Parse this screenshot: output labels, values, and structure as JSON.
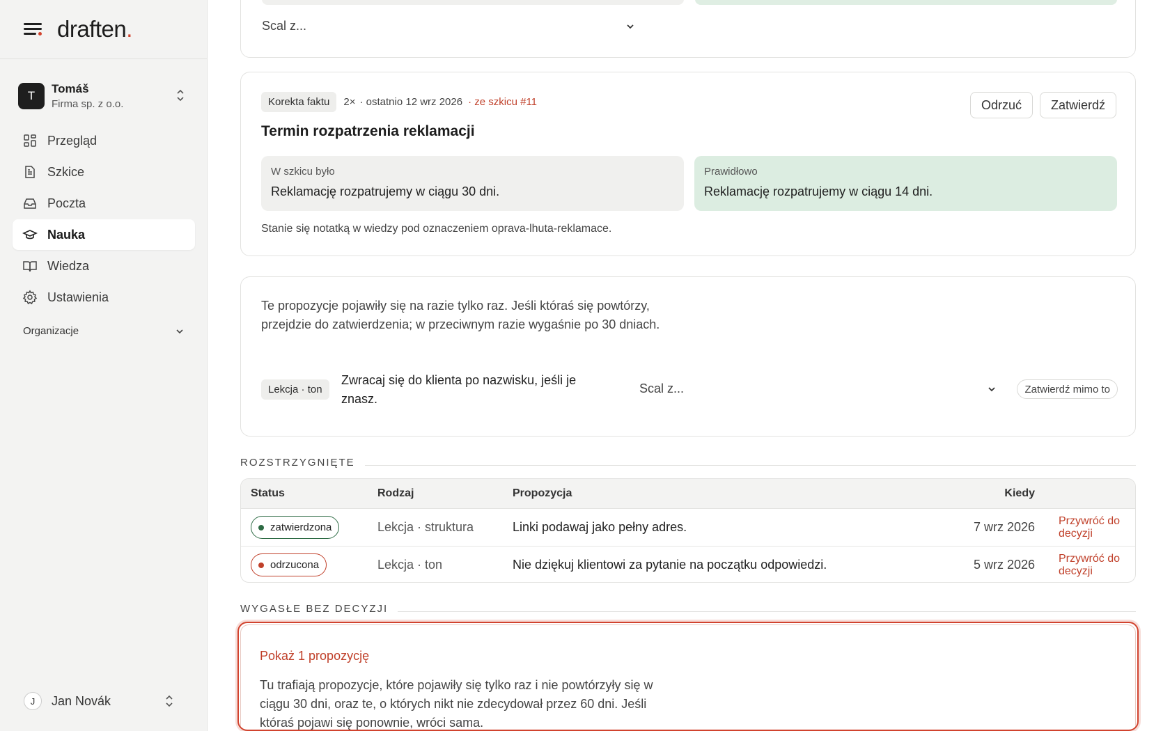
{
  "brand": {
    "name": "draften",
    "dot": "."
  },
  "account": {
    "initial": "T",
    "name": "Tomáš",
    "org": "Firma sp. z o.o."
  },
  "nav": [
    {
      "label": "Przegląd",
      "icon": "grid-icon"
    },
    {
      "label": "Szkice",
      "icon": "document-icon"
    },
    {
      "label": "Poczta",
      "icon": "inbox-icon"
    },
    {
      "label": "Nauka",
      "icon": "graduation-cap-icon",
      "active": true
    },
    {
      "label": "Wiedza",
      "icon": "book-icon"
    },
    {
      "label": "Ustawienia",
      "icon": "gear-icon"
    }
  ],
  "organizations_label": "Organizacje",
  "user": {
    "initial": "J",
    "name": "Jan Novák"
  },
  "top_card": {
    "merge_placeholder": "Scal z..."
  },
  "fact_card": {
    "tag": "Korekta faktu",
    "count": "2×",
    "last_seen": "· ostatnio 12 wrz 2026",
    "source": "· ze szkicu #11",
    "reject_label": "Odrzuć",
    "approve_label": "Zatwierdź",
    "title": "Termin rozpatrzenia reklamacji",
    "was_label": "W szkicu było",
    "was_text": "Reklamację rozpatrujemy w ciągu 30 dni.",
    "correct_label": "Prawidłowo",
    "correct_text": "Reklamację rozpatrujemy w ciągu 14 dni.",
    "note": "Stanie się notatką w wiedzy pod oznaczeniem oprava-lhuta-reklamace."
  },
  "once_card": {
    "intro": "Te propozycje pojawiły się na razie tylko raz. Jeśli któraś się powtórzy, przejdzie do zatwierdzenia; w przeciwnym razie wygaśnie po 30 dniach.",
    "tag": "Lekcja · ton",
    "text": "Zwracaj się do klienta po nazwisku, jeśli je znasz.",
    "merge_placeholder": "Scal z...",
    "approve_anyway_label": "Zatwierdź mimo to"
  },
  "resolved": {
    "heading": "ROZSTRZYGNIĘTE",
    "columns": {
      "status": "Status",
      "kind": "Rodzaj",
      "proposal": "Propozycja",
      "when": "Kiedy"
    },
    "rows": [
      {
        "status": "zatwierdzona",
        "kind": "Lekcja · struktura",
        "proposal": "Linki podawaj jako pełny adres.",
        "when": "7 wrz 2026",
        "action": "Przywróć do decyzji"
      },
      {
        "status": "odrzucona",
        "kind": "Lekcja · ton",
        "proposal": "Nie dziękuj klientowi za pytanie na początku odpowiedzi.",
        "when": "5 wrz 2026",
        "action": "Przywróć do decyzji"
      }
    ]
  },
  "expired": {
    "heading": "WYGASŁE BEZ DECYZJI",
    "show_link": "Pokaż 1 propozycję",
    "text": "Tu trafiają propozycje, które pojawiły się tylko raz i nie powtórzyły się w ciągu 30 dni, oraz te, o których nikt nie zdecydował przez 60 dni. Jeśli któraś pojawi się ponownie, wróci sama."
  },
  "colors": {
    "accent": "#d1432e",
    "approved": "#2d6b44",
    "correct_bg": "#dcede1"
  }
}
